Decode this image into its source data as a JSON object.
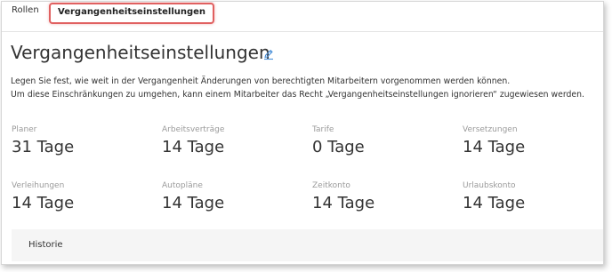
{
  "tabs": [
    {
      "label": "Rollen"
    },
    {
      "label": "Vergangenheitseinstellungen"
    }
  ],
  "page": {
    "title": "Vergangenheitseinstellungen",
    "edit_icon": "pencil-icon",
    "description_line1": "Legen Sie fest, wie weit in der Vergangenheit Änderungen von berechtigten Mitarbeitern vorgenommen werden können.",
    "description_line2": "Um diese Einschränkungen zu umgehen, kann einem Mitarbeiter das Recht „Vergangenheitseinstellungen ignorieren“ zugewiesen werden."
  },
  "stats": [
    {
      "label": "Planer",
      "value": "31 Tage"
    },
    {
      "label": "Arbeitsverträge",
      "value": "14 Tage"
    },
    {
      "label": "Tarife",
      "value": "0 Tage"
    },
    {
      "label": "Versetzungen",
      "value": "14 Tage"
    },
    {
      "label": "Verleihungen",
      "value": "14 Tage"
    },
    {
      "label": "Autopläne",
      "value": "14 Tage"
    },
    {
      "label": "Zeitkonto",
      "value": "14 Tage"
    },
    {
      "label": "Urlaubskonto",
      "value": "14 Tage"
    }
  ],
  "history": {
    "label": "Historie"
  },
  "colors": {
    "accent": "#e06060",
    "edit_icon": "#4a90d9",
    "history_bg": "#f5f5f5"
  }
}
